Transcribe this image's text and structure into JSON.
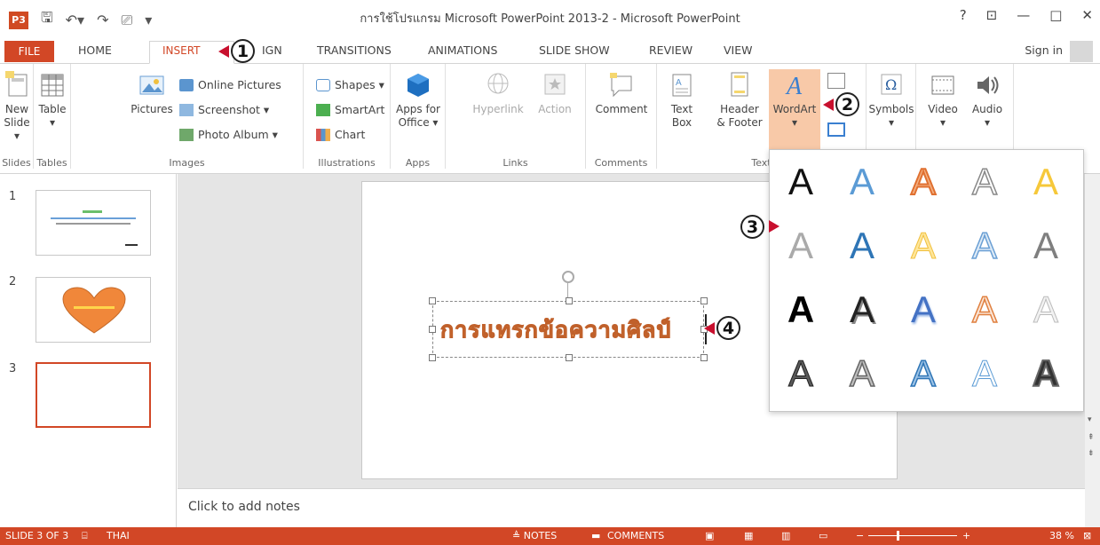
{
  "window": {
    "title": "การใช้โปรแกรม Microsoft PowerPoint 2013-2 - Microsoft PowerPoint",
    "help": "?",
    "minimize": "—",
    "maximize": "□",
    "close": "✕",
    "logo": "P3"
  },
  "tabs": {
    "file": "FILE",
    "home": "HOME",
    "insert": "INSERT",
    "design": "IGN",
    "transitions": "TRANSITIONS",
    "animations": "ANIMATIONS",
    "slideshow": "SLIDE SHOW",
    "review": "REVIEW",
    "view": "VIEW",
    "signin": "Sign in"
  },
  "ribbon": {
    "slides": {
      "new1": "New",
      "new2": "Slide ▾",
      "group": "Slides"
    },
    "tables": {
      "table": "Table",
      "dd": "▾",
      "group": "Tables"
    },
    "images": {
      "pictures": "Pictures",
      "online": "Online Pictures",
      "screenshot": "Screenshot ▾",
      "album": "Photo Album ▾",
      "group": "Images"
    },
    "illustrations": {
      "shapes": "Shapes ▾",
      "smartart": "SmartArt",
      "chart": "Chart",
      "group": "Illustrations"
    },
    "apps": {
      "apps1": "Apps for",
      "apps2": "Office ▾",
      "group": "Apps"
    },
    "links": {
      "hyperlink": "Hyperlink",
      "action": "Action",
      "group": "Links"
    },
    "comments": {
      "comment": "Comment",
      "group": "Comments"
    },
    "text": {
      "tb1": "Text",
      "tb2": "Box",
      "hf1": "Header",
      "hf2": "& Footer",
      "wordart": "WordArt",
      "dd": "▾",
      "group": "Text"
    },
    "symbols": {
      "symbols": "Symbols",
      "dd": "▾"
    },
    "media": {
      "video": "Video",
      "audio": "Audio",
      "dd": "▾"
    }
  },
  "slides": [
    {
      "num": "1"
    },
    {
      "num": "2"
    },
    {
      "num": "3"
    }
  ],
  "slide_text": "การแทรกข้อความศิลป์",
  "wordart_gallery": [
    "A",
    "A",
    "A",
    "A",
    "A",
    "A",
    "A",
    "A",
    "A",
    "A",
    "A",
    "A",
    "A",
    "A",
    "A",
    "A",
    "A",
    "A",
    "A",
    "A"
  ],
  "notes": "Click to add notes",
  "status": {
    "slide": "SLIDE 3 OF 3",
    "lang": "THAI",
    "notes": "≜ NOTES",
    "comments": "COMMENTS",
    "zoom": "38 %"
  },
  "callouts": [
    "1",
    "2",
    "3",
    "4"
  ],
  "colors": {
    "accent": "#d24726",
    "wordart": "#f29b4a",
    "callout_arrow": "#c8102e"
  }
}
